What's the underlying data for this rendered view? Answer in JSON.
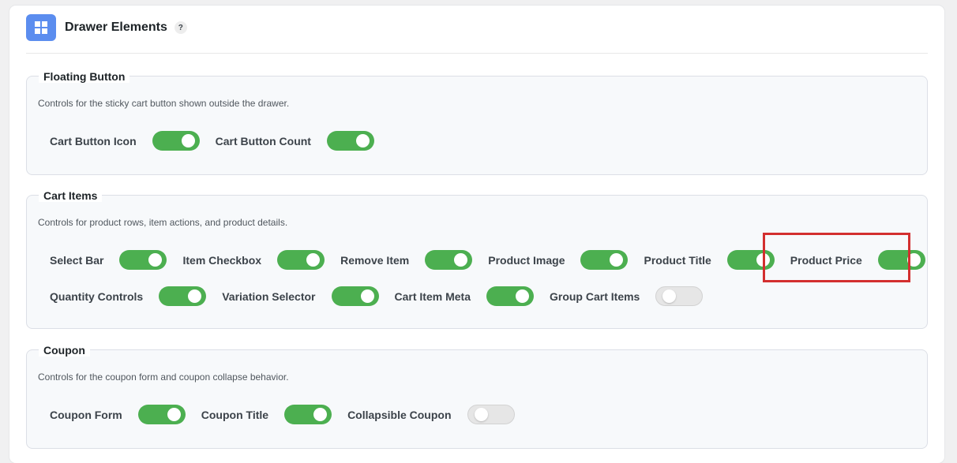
{
  "header": {
    "title": "Drawer Elements",
    "help": "?",
    "icon": "grid-icon",
    "icon_color": "#5b8def"
  },
  "sections": [
    {
      "title": "Floating Button",
      "description": "Controls for the sticky cart button shown outside the drawer.",
      "rows": [
        [
          {
            "label": "Cart Button Icon",
            "on": true
          },
          {
            "label": "Cart Button Count",
            "on": true
          }
        ]
      ]
    },
    {
      "title": "Cart Items",
      "description": "Controls for product rows, item actions, and product details.",
      "rows": [
        [
          {
            "label": "Select Bar",
            "on": true
          },
          {
            "label": "Item Checkbox",
            "on": true
          },
          {
            "label": "Remove Item",
            "on": true
          },
          {
            "label": "Product Image",
            "on": true
          },
          {
            "label": "Product Title",
            "on": true
          },
          {
            "label": "Product Price",
            "on": true
          }
        ],
        [
          {
            "label": "Quantity Controls",
            "on": true
          },
          {
            "label": "Variation Selector",
            "on": true
          },
          {
            "label": "Cart Item Meta",
            "on": true
          },
          {
            "label": "Group Cart Items",
            "on": false
          }
        ]
      ]
    },
    {
      "title": "Coupon",
      "description": "Controls for the coupon form and coupon collapse behavior.",
      "rows": [
        [
          {
            "label": "Coupon Form",
            "on": true
          },
          {
            "label": "Coupon Title",
            "on": true
          },
          {
            "label": "Collapsible Coupon",
            "on": false
          }
        ]
      ]
    }
  ],
  "colors": {
    "toggle_on": "#4caf50",
    "toggle_off": "#e6e6e6",
    "highlight": "#d32f2f"
  }
}
